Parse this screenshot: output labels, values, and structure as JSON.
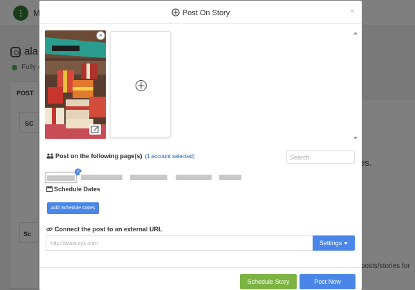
{
  "background": {
    "topbar_text": "M",
    "account_name": "ala",
    "status_text": "Fully c",
    "tab_label": "POST",
    "box1_text": "SC",
    "box2_text": "Sc",
    "right_text1": "es.",
    "right_text2": "posts/stories for"
  },
  "modal": {
    "title": "Post On Story",
    "close_label": "×",
    "pages_label": "Post on the following page(s)",
    "selected_count": "(1 account selected)",
    "search_placeholder": "Search",
    "schedule_label": "Schedule Dates",
    "add_schedule_label": "Add Schedule Dates",
    "url_label": "Connect the post to an external URL",
    "url_placeholder": "http://www.xyz.com",
    "settings_label": "Settings",
    "schedule_story_label": "Schedule Story",
    "post_now_label": "Post Now",
    "remove_label": "×"
  },
  "colors": {
    "primary": "#4a86e8",
    "success": "#7cb342",
    "link": "#1a56c4",
    "status_dot": "#4caf50"
  },
  "icons": {
    "title_icon": "plus-circle-icon",
    "pages_icon": "users-icon",
    "schedule_icon": "calendar-icon",
    "url_icon": "link-icon",
    "add_media_icon": "plus-circle-icon",
    "edit_icon": "edit-icon",
    "check_icon": "check-icon"
  }
}
